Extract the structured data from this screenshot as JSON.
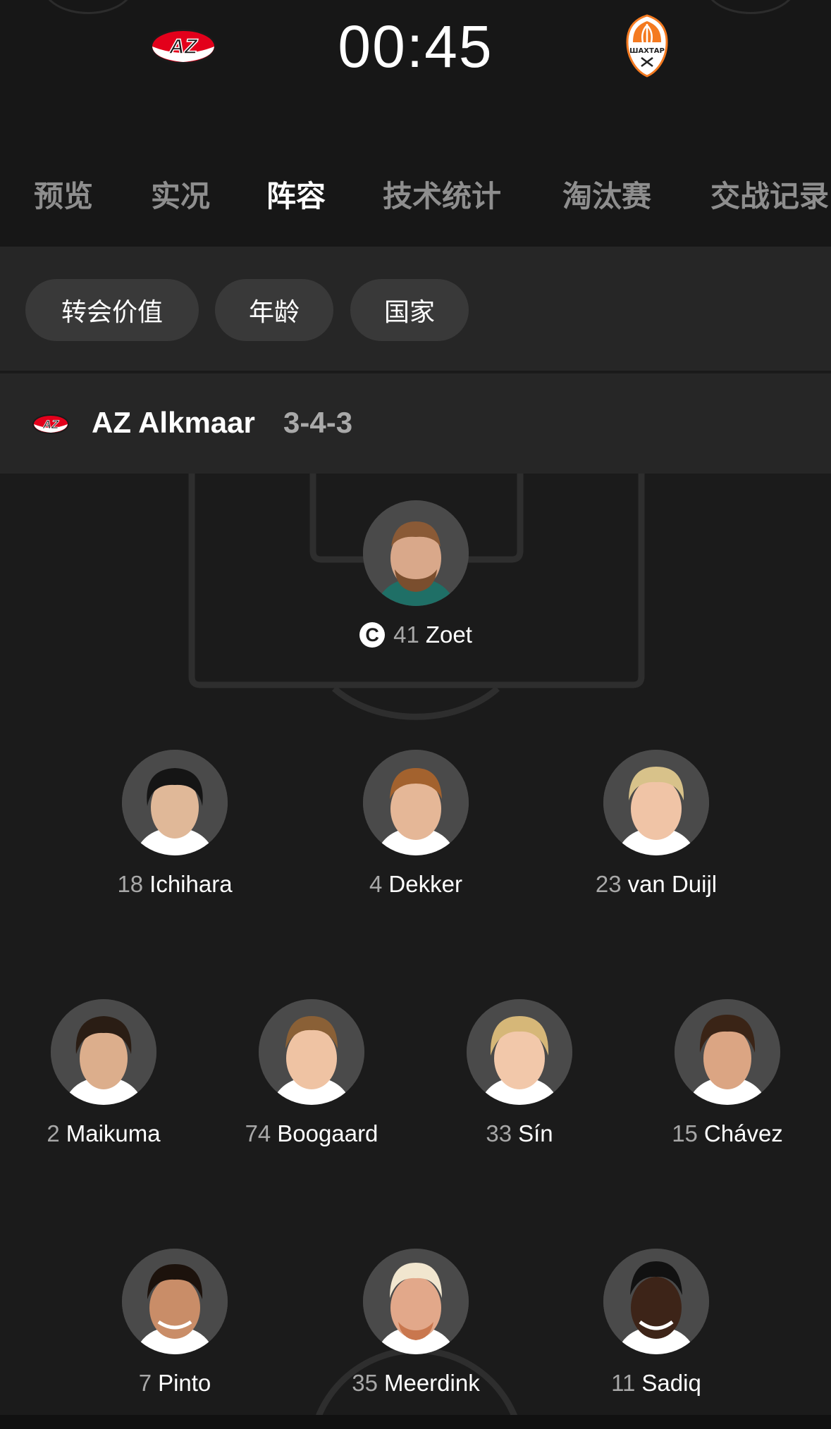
{
  "match": {
    "clock": "00:45",
    "home_team": {
      "name": "AZ Alkmaar",
      "logo": "az-logo",
      "logo_text": "AZ",
      "colors": {
        "primary": "#e3001b",
        "secondary": "#ffffff",
        "dark": "#1a1a1a"
      }
    },
    "away_team": {
      "logo": "shakhtar-logo",
      "logo_text": "ШАХТАР",
      "colors": {
        "primary": "#f47a20",
        "secondary": "#ffffff"
      }
    }
  },
  "tabs": [
    {
      "label": "预览",
      "active": false
    },
    {
      "label": "实况",
      "active": false
    },
    {
      "label": "阵容",
      "active": true
    },
    {
      "label": "技术统计",
      "active": false
    },
    {
      "label": "淘汰赛",
      "active": false
    },
    {
      "label": "交战记录",
      "active": false
    }
  ],
  "filters": [
    {
      "label": "转会价值"
    },
    {
      "label": "年龄"
    },
    {
      "label": "国家"
    }
  ],
  "lineup": {
    "team_name": "AZ Alkmaar",
    "formation": "3-4-3",
    "captain_badge": "C",
    "rows": [
      [
        {
          "number": "41",
          "name": "Zoet",
          "captain": true
        }
      ],
      [
        {
          "number": "18",
          "name": "Ichihara"
        },
        {
          "number": "4",
          "name": "Dekker"
        },
        {
          "number": "23",
          "name": "van Duijl"
        }
      ],
      [
        {
          "number": "2",
          "name": "Maikuma"
        },
        {
          "number": "74",
          "name": "Boogaard"
        },
        {
          "number": "33",
          "name": "Sín"
        },
        {
          "number": "15",
          "name": "Chávez"
        }
      ],
      [
        {
          "number": "7",
          "name": "Pinto"
        },
        {
          "number": "35",
          "name": "Meerdink"
        },
        {
          "number": "11",
          "name": "Sadiq"
        }
      ]
    ]
  },
  "icons": {
    "captain": "captain-icon",
    "avatar": "player-photo"
  },
  "theme": {
    "background": "#1b1b1b",
    "panel": "#262626",
    "chip": "#393939",
    "tab_inactive": "#8e8e8e",
    "muted_number": "#a8a8a8",
    "pitch_lines": "#2e2e2e"
  }
}
